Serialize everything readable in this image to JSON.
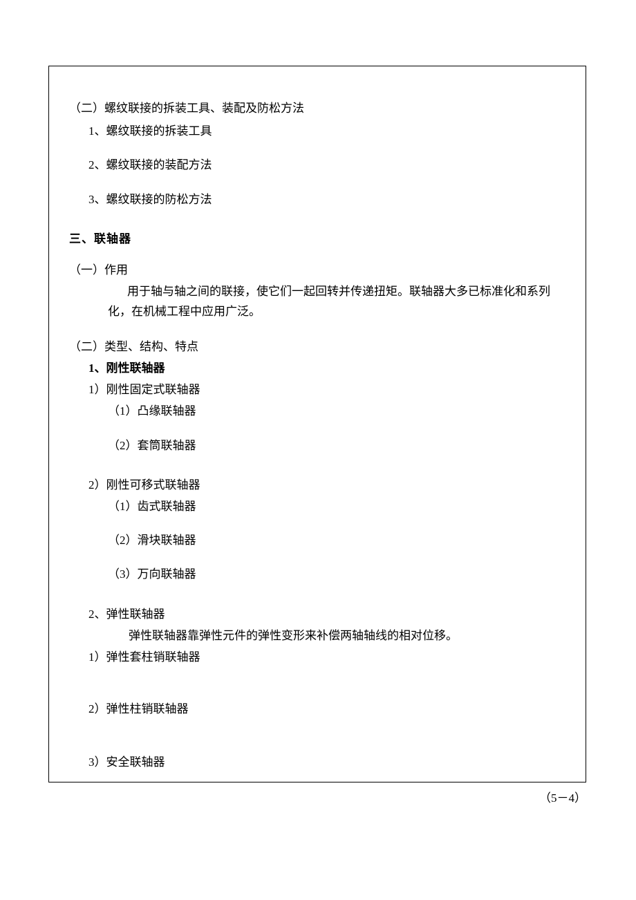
{
  "section2": {
    "heading": "（二）螺纹联接的拆装工具、装配及防松方法",
    "items": [
      "1、螺纹联接的拆装工具",
      "2、螺纹联接的装配方法",
      "3、螺纹联接的防松方法"
    ]
  },
  "section3": {
    "heading": "三、联轴器",
    "sub1": {
      "heading": "（一）作用",
      "body": "用于轴与轴之间的联接，使它们一起回转并传递扭矩。联轴器大多已标准化和系列化，在机械工程中应用广泛。"
    },
    "sub2": {
      "heading": "（二）类型、结构、特点",
      "group1": {
        "title": "1、刚性联轴器",
        "a": {
          "title": "1）刚性固定式联轴器",
          "items": [
            "（1）凸缘联轴器",
            "（2）套筒联轴器"
          ]
        },
        "b": {
          "title": "2）刚性可移式联轴器",
          "items": [
            "（1）齿式联轴器",
            "（2）滑块联轴器",
            "（3）万向联轴器"
          ]
        }
      },
      "group2": {
        "title": "2、弹性联轴器",
        "body": "弹性联轴器靠弹性元件的弹性变形来补偿两轴轴线的相对位移。",
        "items": [
          "1）弹性套柱销联轴器",
          "2）弹性柱销联轴器",
          "3）安全联轴器"
        ]
      }
    }
  },
  "pageNumber": "（5－4）"
}
